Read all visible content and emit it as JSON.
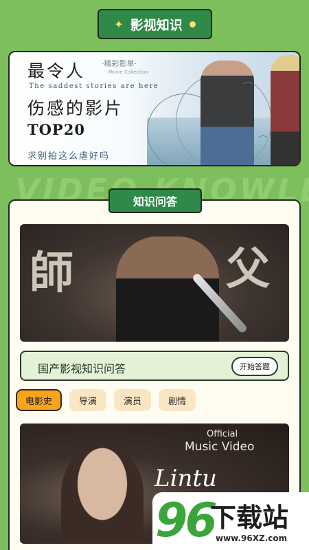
{
  "header": {
    "title": "影视知识"
  },
  "banner": {
    "line1": "最令人",
    "tag": "·精彩影单·",
    "tag_en": "Movie Collection",
    "english": "The saddest stories are here",
    "line2": "伤感的影片",
    "top": "TOP20",
    "subtitle": "求别拍这么虐好吗"
  },
  "watermark": "VIDEO KNOWLE",
  "section": {
    "title": "知识问答",
    "poster1_text": "師父",
    "quiz_label": "国产影视知识问答",
    "quiz_button": "开始答题",
    "tags": [
      "电影史",
      "导演",
      "演员",
      "剧情"
    ],
    "poster2_official": "Official",
    "poster2_music": "Music Video",
    "poster2_script": "Lintu Yiwoa"
  },
  "badge": {
    "number": "96",
    "word": "下载站",
    "url": "www.96XZ.com"
  },
  "colors": {
    "background": "#7cbf5c",
    "accent": "#2f8a4a",
    "active_tag": "#f8a51c",
    "tag": "#fbe6c4"
  }
}
